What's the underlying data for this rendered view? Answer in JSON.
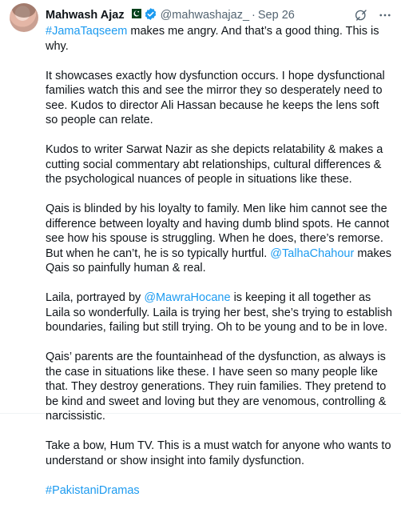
{
  "author": {
    "name": "Mahwash Ajaz",
    "handle": "@mahwashajaz_",
    "separator": "·",
    "date": "Sep 26"
  },
  "colors": {
    "link": "#1d9bf0",
    "verified": "#1d9bf0",
    "muted": "#536471",
    "text": "#0f1419"
  },
  "icons": {
    "flag": "pakistan-flag-icon",
    "verified": "verified-badge-icon",
    "grok": "grok-icon",
    "more": "more-icon"
  },
  "tweet": {
    "p1_hashtag": "#JamaTaqseem",
    "p1_text": " makes me angry. And that’s a good thing. This is why.",
    "p2": "It showcases exactly how dysfunction occurs. I hope dysfunctional families watch this and see the mirror they so desperately need to see. Kudos to director Ali Hassan because he keeps the lens soft so people can relate.",
    "p3": "Kudos to writer Sarwat Nazir as she depicts relatability & makes a cutting social commentary abt relationships, cultural differences & the psychological nuances of people in situations like these.",
    "p4_text": "Qais is blinded by his loyalty to family. Men like him cannot see the difference between loyalty and having dumb blind spots. He cannot see how his spouse is struggling. When he does, there’s remorse. But when he can’t, he is so typically hurtful. ",
    "p4_mention": "@TalhaChahour",
    "p4_text2": " makes Qais so painfully human & real.",
    "p5_text": "Laila, portrayed by ",
    "p5_mention": "@MawraHocane",
    "p5_text2": " is keeping it all together as Laila so wonderfully. Laila is trying her best, she’s trying to establish boundaries, failing but still trying. Oh to be young and to be in love.",
    "p6": "Qais’ parents are the fountainhead of the dysfunction, as always is the case in situations like these. I have seen so many people like that. They destroy generations. They ruin families. They pretend to be kind and sweet and loving but they are venomous, controlling & narcissistic.",
    "p7": "Take a bow, Hum TV.  This is a must watch for anyone who wants to understand or show insight into family dysfunction.",
    "p8_hashtag": "#PakistaniDramas"
  }
}
